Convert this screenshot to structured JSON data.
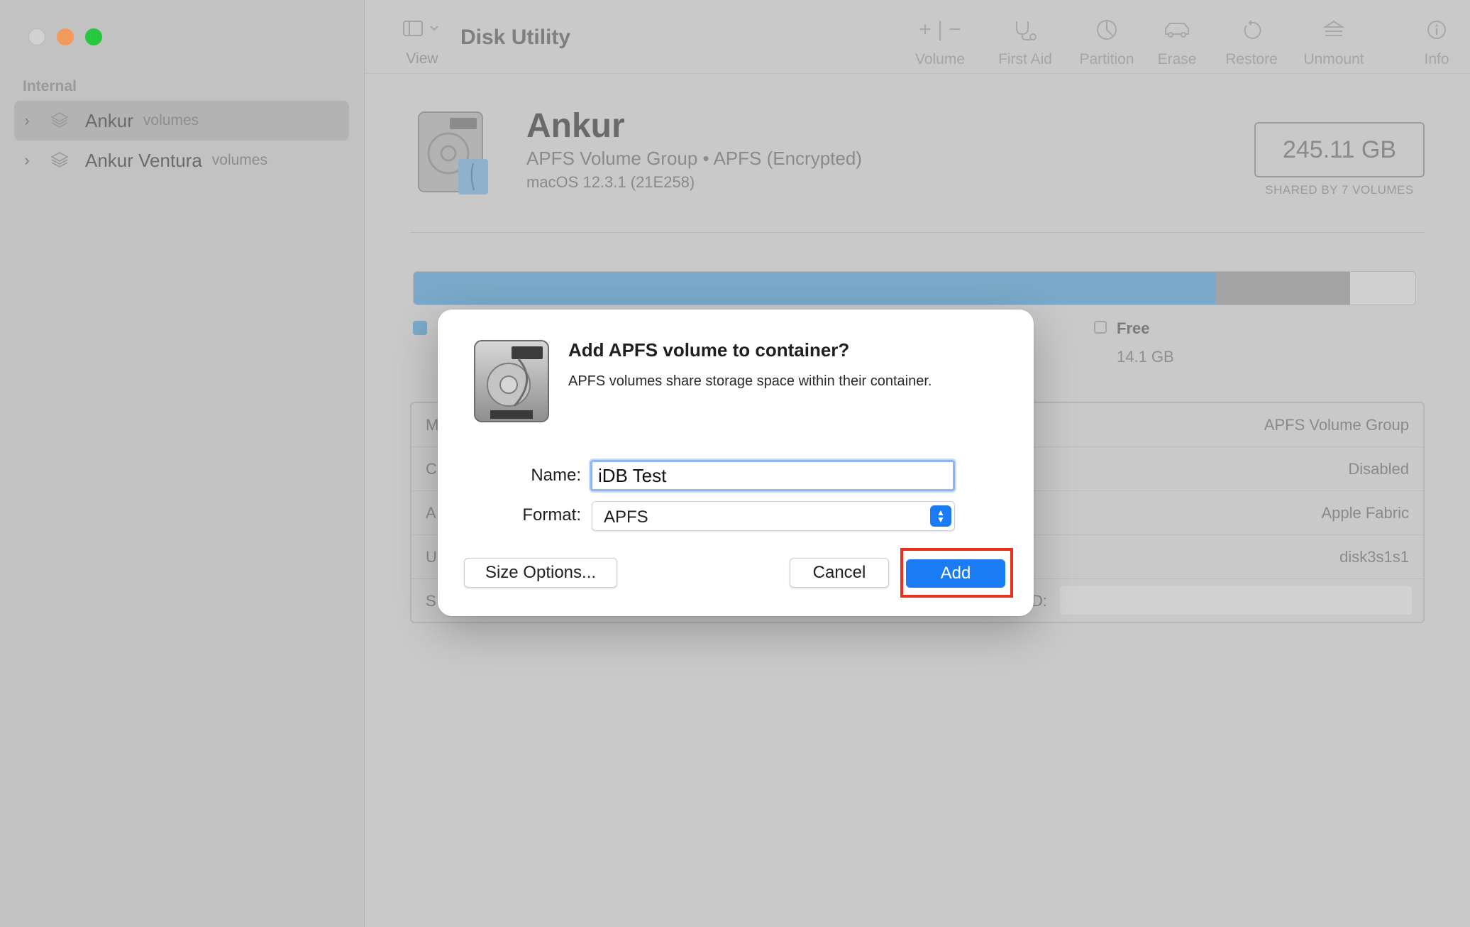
{
  "app": {
    "title": "Disk Utility"
  },
  "sidebar": {
    "section": "Internal",
    "items": [
      {
        "name": "Ankur",
        "sub": "volumes"
      },
      {
        "name": "Ankur Ventura",
        "sub": "volumes"
      }
    ]
  },
  "toolbar": {
    "view_label": "View",
    "buttons": [
      {
        "icon": "plus-minus-icon",
        "label": "Volume"
      },
      {
        "icon": "stethoscope-icon",
        "label": "First Aid"
      },
      {
        "icon": "pie-chart-icon",
        "label": "Partition"
      },
      {
        "icon": "eraser-car-icon",
        "label": "Erase"
      },
      {
        "icon": "restore-arrow-icon",
        "label": "Restore"
      },
      {
        "icon": "unmount-icon",
        "label": "Unmount"
      },
      {
        "icon": "info-icon",
        "label": "Info"
      }
    ]
  },
  "volume": {
    "name": "Ankur",
    "subtitle": "APFS Volume Group • APFS (Encrypted)",
    "os": "macOS 12.3.1 (21E258)",
    "size": "245.11 GB",
    "size_caption": "SHARED BY 7 VOLUMES"
  },
  "usage": {
    "used_fraction": 0.8,
    "other_fraction": 0.135,
    "free_label": "Free",
    "free_value": "14.1 GB"
  },
  "info_rows": [
    {
      "key": "M",
      "value": "APFS Volume Group"
    },
    {
      "key": "C",
      "value": "Disabled"
    },
    {
      "key": "A",
      "value": "Apple Fabric"
    },
    {
      "key": "U",
      "value": "disk3s1s1"
    },
    {
      "key": "S",
      "detail_label": "D:",
      "value": ""
    }
  ],
  "dialog": {
    "title": "Add APFS volume to container?",
    "message": "APFS volumes share storage space within their container.",
    "name_label": "Name:",
    "name_value": "iDB Test",
    "format_label": "Format:",
    "format_value": "APFS",
    "size_options_label": "Size Options...",
    "cancel_label": "Cancel",
    "add_label": "Add"
  },
  "colors": {
    "accent": "#1a7bf5",
    "highlight": "#e8321f",
    "used_bar": "#7aa9c9"
  }
}
